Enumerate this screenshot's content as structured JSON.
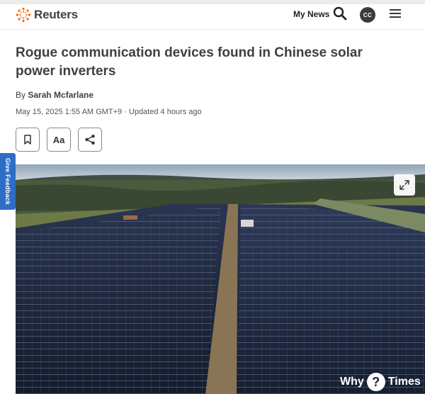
{
  "header": {
    "logo_text": "Reuters",
    "my_news": "My News",
    "avatar_initials": "CC",
    "search_icon": "search-icon",
    "menu_icon": "hamburger-menu-icon",
    "brand_color": "#fa6400"
  },
  "article": {
    "headline": "Rogue communication devices found in Chinese solar power inverters",
    "byline_prefix": "By ",
    "author": "Sarah Mcfarlane",
    "dateline": "May 15, 2025 1:55 AM GMT+9 · Updated 4 hours ago"
  },
  "actions": {
    "bookmark_icon": "bookmark-icon",
    "text_size_label": "Aa",
    "share_icon": "share-icon"
  },
  "feedback": {
    "label": "Give Feedback",
    "color": "#2d6dc6"
  },
  "image": {
    "expand_icon": "expand-icon"
  },
  "watermark": {
    "left": "Why",
    "middle": "?",
    "right": "Times"
  }
}
